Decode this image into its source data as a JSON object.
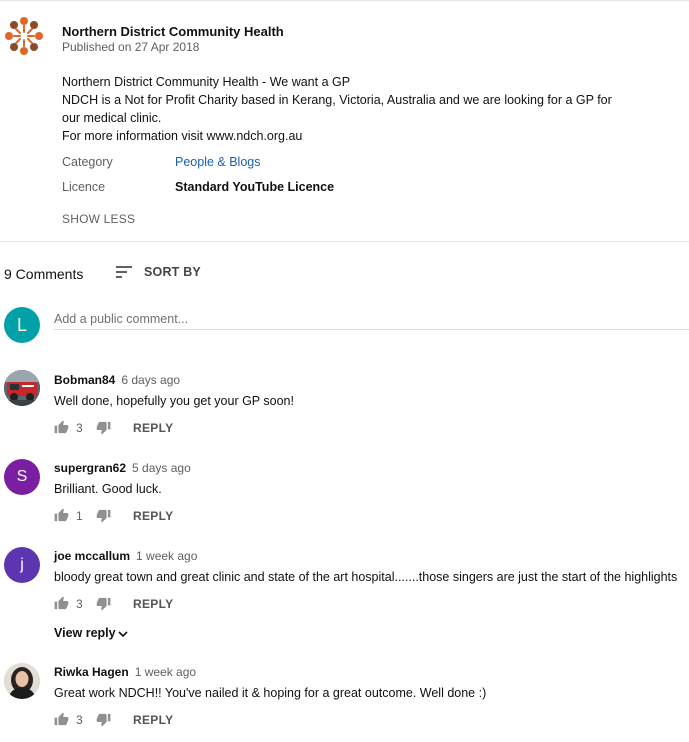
{
  "video": {
    "channel_name": "Northern District Community Health",
    "published": "Published on 27 Apr 2018",
    "description_lines": [
      "Northern District Community Health - We want a GP",
      "NDCH is a Not for Profit Charity based in Kerang, Victoria, Australia and we are looking for a GP for",
      "our medical clinic.",
      "For more information visit www.ndch.org.au"
    ],
    "category_label": "Category",
    "category_value": "People & Blogs",
    "licence_label": "Licence",
    "licence_value": "Standard YouTube Licence",
    "show_less": "SHOW LESS",
    "logo_colors": [
      "#e0662a",
      "#8a4b2b"
    ]
  },
  "comments_header": {
    "count_label": "9 Comments",
    "sort_label": "SORT BY",
    "sort_icon": "sort-icon"
  },
  "add_comment": {
    "avatar_letter": "L",
    "avatar_color": "#00a2a8",
    "placeholder": "Add a public comment..."
  },
  "comments": [
    {
      "author": "Bobman84",
      "time": "6 days ago",
      "text": "Well done, hopefully you get your GP soon!",
      "likes": "3",
      "reply_label": "REPLY",
      "avatar": "photo-fire-truck"
    },
    {
      "author": "supergran62",
      "time": "5 days ago",
      "text": "Brilliant. Good luck.",
      "likes": "1",
      "reply_label": "REPLY",
      "avatar_letter": "S",
      "avatar_color": "#7b1fa2"
    },
    {
      "author": "joe mccallum",
      "time": "1 week ago",
      "text": "bloody great town and great clinic and state of the art hospital.......those singers are just the start of the highlights",
      "likes": "3",
      "reply_label": "REPLY",
      "avatar_letter": "j",
      "avatar_color": "#5e35b1",
      "view_reply": "View reply"
    },
    {
      "author": "Riwka Hagen",
      "time": "1 week ago",
      "text": "Great work NDCH!! You've nailed it & hoping for a great outcome. Well done :)",
      "likes": "3",
      "reply_label": "REPLY",
      "avatar": "photo-woman"
    }
  ]
}
